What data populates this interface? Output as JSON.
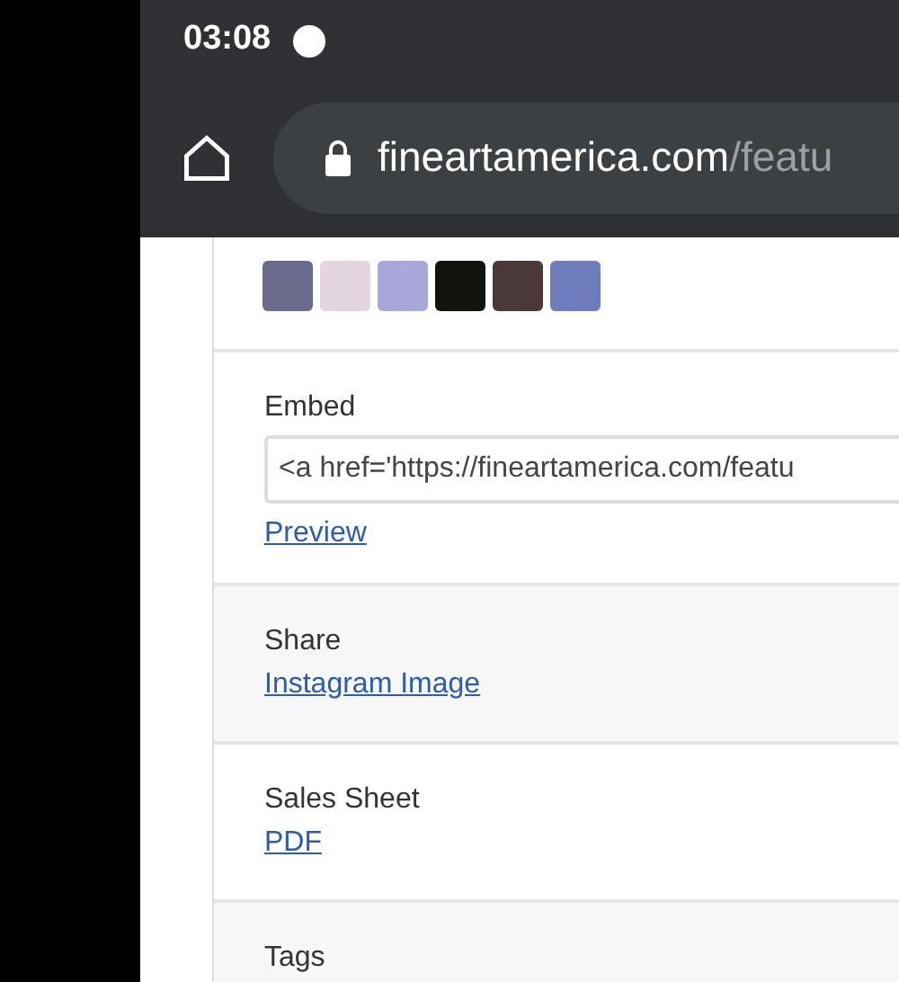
{
  "status_bar": {
    "time": "03:08"
  },
  "address_bar": {
    "domain": "fineartamerica.com",
    "path": "/featu"
  },
  "colors": [
    {
      "color": "#6c6a8c"
    },
    {
      "color": "#e3d6df"
    },
    {
      "color": "#a9a6d9"
    },
    {
      "color": "#12120e"
    },
    {
      "color": "#4a383b"
    },
    {
      "color": "#6e7bbd"
    }
  ],
  "sections": [
    {
      "title": "Embed",
      "field_value": "<a href='https://fineartamerica.com/featu",
      "link": "Preview"
    },
    {
      "title": "Share",
      "link": "Instagram Image"
    },
    {
      "title": "Sales Sheet",
      "link": "PDF"
    },
    {
      "title": "Tags"
    }
  ]
}
